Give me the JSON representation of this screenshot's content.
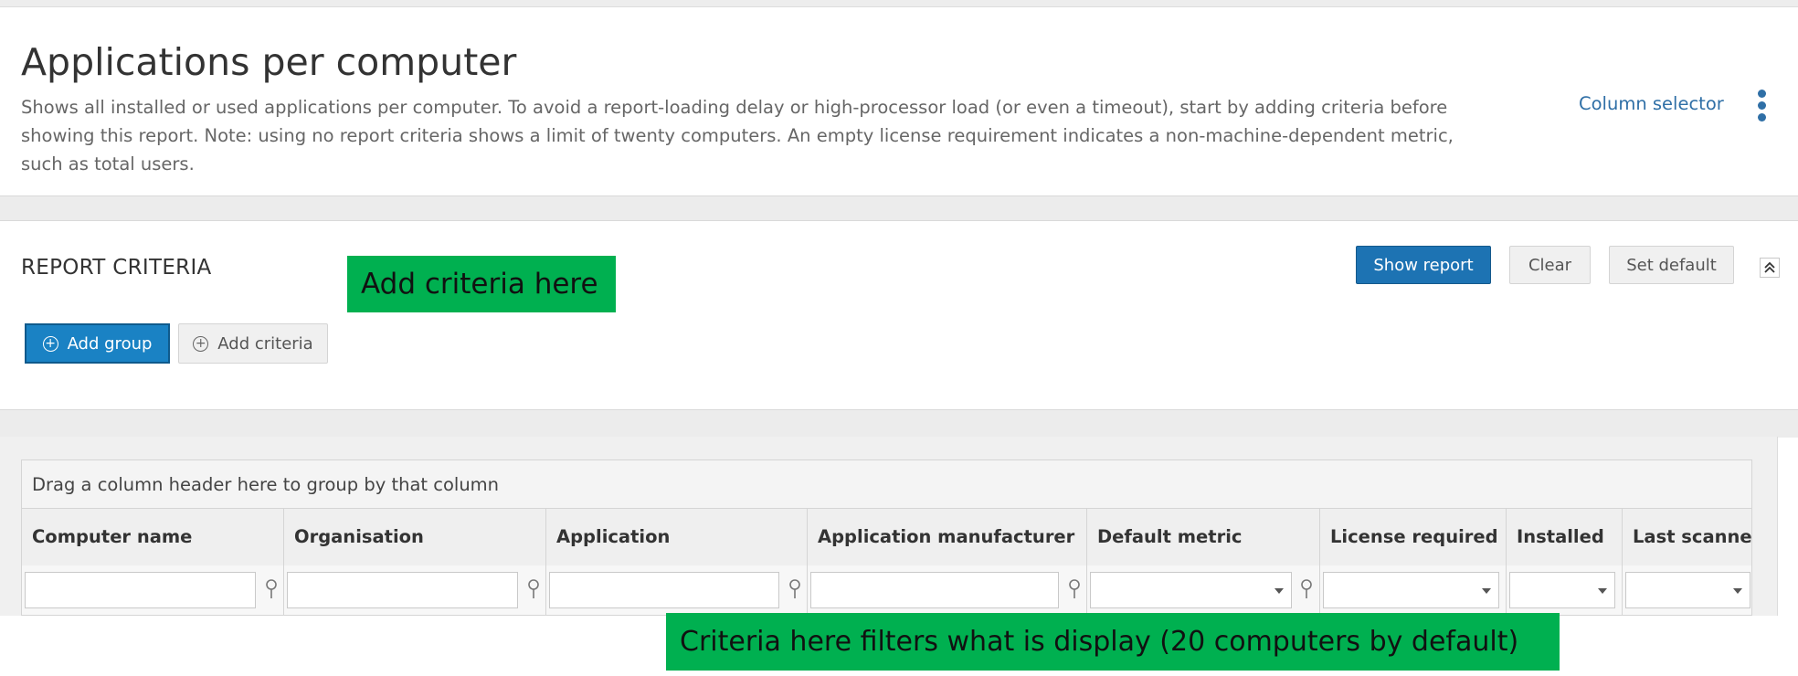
{
  "header": {
    "title": "Applications per computer",
    "description": "Shows all installed or used applications per computer. To avoid a report-loading delay or high-processor load (or even a timeout), start by adding criteria before showing this report. Note: using no report criteria shows a limit of twenty computers. An empty license requirement indicates a non-machine-dependent metric, such as total users.",
    "column_selector": "Column selector",
    "more_icon": "vertical-ellipsis-icon"
  },
  "criteria": {
    "title": "REPORT CRITERIA",
    "add_group": "Add group",
    "add_criteria": "Add criteria",
    "show_report": "Show report",
    "clear": "Clear",
    "set_default": "Set default",
    "collapse_icon": "double-chevron-up-icon"
  },
  "callouts": {
    "add_criteria_note": "Add criteria here",
    "filter_note": "Criteria here filters what is display (20 computers by default)"
  },
  "grid": {
    "group_hint": "Drag a column header here to group by that column",
    "columns": [
      {
        "label": "Computer name",
        "filter": "text"
      },
      {
        "label": "Organisation",
        "filter": "text"
      },
      {
        "label": "Application",
        "filter": "text"
      },
      {
        "label": "Application manufacturer",
        "filter": "text"
      },
      {
        "label": "Default metric",
        "filter": "select-with-filter"
      },
      {
        "label": "License required",
        "filter": "select"
      },
      {
        "label": "Installed",
        "filter": "select"
      },
      {
        "label": "Last scanned",
        "filter": "select"
      }
    ]
  },
  "colors": {
    "accent": "#1d73b3",
    "link": "#2f6fa6",
    "callout": "#00b050"
  }
}
